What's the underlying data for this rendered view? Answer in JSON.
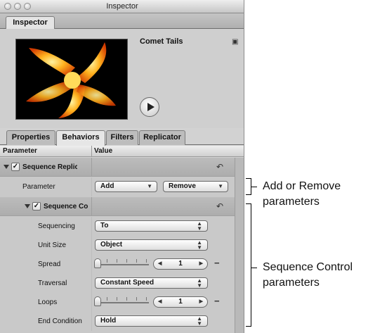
{
  "window": {
    "title": "Inspector",
    "main_tab": "Inspector"
  },
  "preview": {
    "name": "Comet Tails"
  },
  "subtabs": [
    "Properties",
    "Behaviors",
    "Filters",
    "Replicator"
  ],
  "columns": {
    "parameter": "Parameter",
    "value": "Value"
  },
  "rows": {
    "group1": "Sequence Replica",
    "parameter_label": "Parameter",
    "add_popup": "Add",
    "remove_popup": "Remove",
    "group2": "Sequence Co",
    "sequencing_label": "Sequencing",
    "sequencing_value": "To",
    "unit_size_label": "Unit Size",
    "unit_size_value": "Object",
    "spread_label": "Spread",
    "spread_value": "1",
    "traversal_label": "Traversal",
    "traversal_value": "Constant Speed",
    "loops_label": "Loops",
    "loops_value": "1",
    "end_condition_label": "End Condition",
    "end_condition_value": "Hold"
  },
  "callouts": {
    "add_remove_line1": "Add or Remove",
    "add_remove_line2": "parameters",
    "sequence_line1": "Sequence Control",
    "sequence_line2": "parameters"
  },
  "icons": {
    "lock": "lock-icon",
    "play": "play-icon",
    "reset": "reset-arrow-icon",
    "disclosure": "disclosure-triangle-icon"
  },
  "colors": {
    "panel": "#d2d2d2",
    "group_row": "#b4b4b4",
    "preview_bg": "#000000",
    "comet": "#ff9c1a"
  }
}
